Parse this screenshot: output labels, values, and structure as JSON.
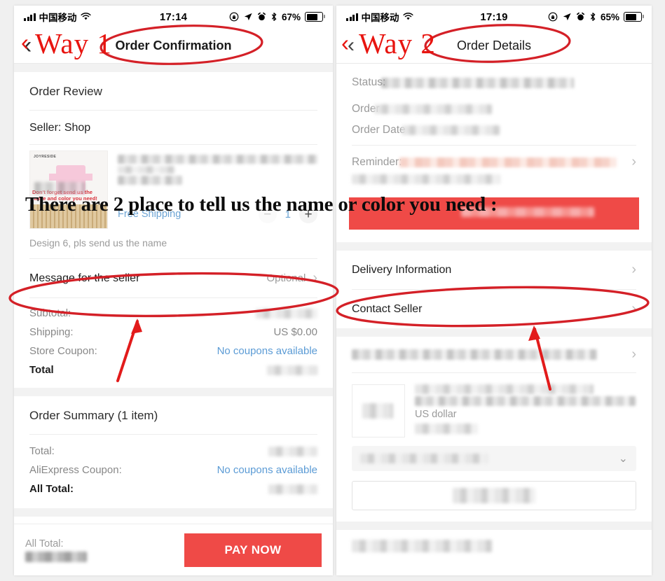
{
  "annotation": {
    "headline": "There are 2 place to tell us the name or color you need :",
    "way1_label": "Way 1",
    "way2_label": "Way 2",
    "back_chevron": "‹",
    "accent_red": "#e8140f",
    "brand_red": "#ef4a47",
    "link_blue": "#5b9bd5"
  },
  "left_panel": {
    "status_bar": {
      "carrier": "中国移动",
      "time": "17:14",
      "battery_pct": "67%",
      "icons": [
        "signal-bars-icon",
        "wifi-icon",
        "rotation-lock-icon",
        "location-arrow-icon",
        "alarm-clock-icon",
        "bluetooth-icon",
        "battery-icon"
      ]
    },
    "nav": {
      "back": "‹",
      "title": "Order Confirmation"
    },
    "order_review": {
      "heading": "Order Review",
      "seller_label": "Seller:",
      "seller_name": "Shop"
    },
    "product": {
      "thumb_brand": "JOYRESIDE",
      "thumb_note": "Don't forget send us the name and color you need!",
      "shipping": "Free Shipping",
      "quantity": "1",
      "minus": "−",
      "plus": "+",
      "variant": "Design 6, pls send us the name"
    },
    "message_row": {
      "label": "Message for the seller",
      "value": "Optional",
      "chevron": "›"
    },
    "totals": [
      {
        "label": "Subtotal:",
        "value": "",
        "redacted": true
      },
      {
        "label": "Shipping:",
        "value": "US $0.00",
        "redacted": false
      },
      {
        "label": "Store Coupon:",
        "value": "No coupons available",
        "link": true
      },
      {
        "label": "Total",
        "value": "",
        "redacted": true,
        "bold": true
      }
    ],
    "order_summary": {
      "heading": "Order Summary (1 item)",
      "rows": [
        {
          "label": "Total:",
          "value": "",
          "redacted": true
        },
        {
          "label": "AliExpress Coupon:",
          "value": "No coupons available",
          "link": true
        },
        {
          "label": "All Total:",
          "value": "",
          "redacted": true,
          "bold": true
        }
      ]
    },
    "pay_bar": {
      "all_total_label": "All Total:",
      "all_total_value": "",
      "pay_button": "PAY NOW"
    }
  },
  "right_panel": {
    "status_bar": {
      "carrier": "中国移动",
      "time": "17:19",
      "battery_pct": "65%",
      "icons": [
        "signal-bars-icon",
        "wifi-icon",
        "rotation-lock-icon",
        "location-arrow-icon",
        "alarm-clock-icon",
        "bluetooth-icon",
        "battery-icon"
      ]
    },
    "nav": {
      "back": "‹",
      "title": "Order Details"
    },
    "status_fields": [
      {
        "label": "Status:",
        "value": "",
        "redacted": true
      },
      {
        "label": "Order",
        "value": "",
        "redacted": true
      },
      {
        "label": "Order Date",
        "value": "",
        "redacted": true
      },
      {
        "label": "Reminder:",
        "value": "",
        "redacted": true
      }
    ],
    "links": [
      {
        "label": "Delivery Information",
        "chevron": "›"
      },
      {
        "label": "Contact Seller",
        "chevron": "›"
      }
    ],
    "order_item": {
      "price_unit": "US dollar",
      "caret": "⌄"
    }
  }
}
